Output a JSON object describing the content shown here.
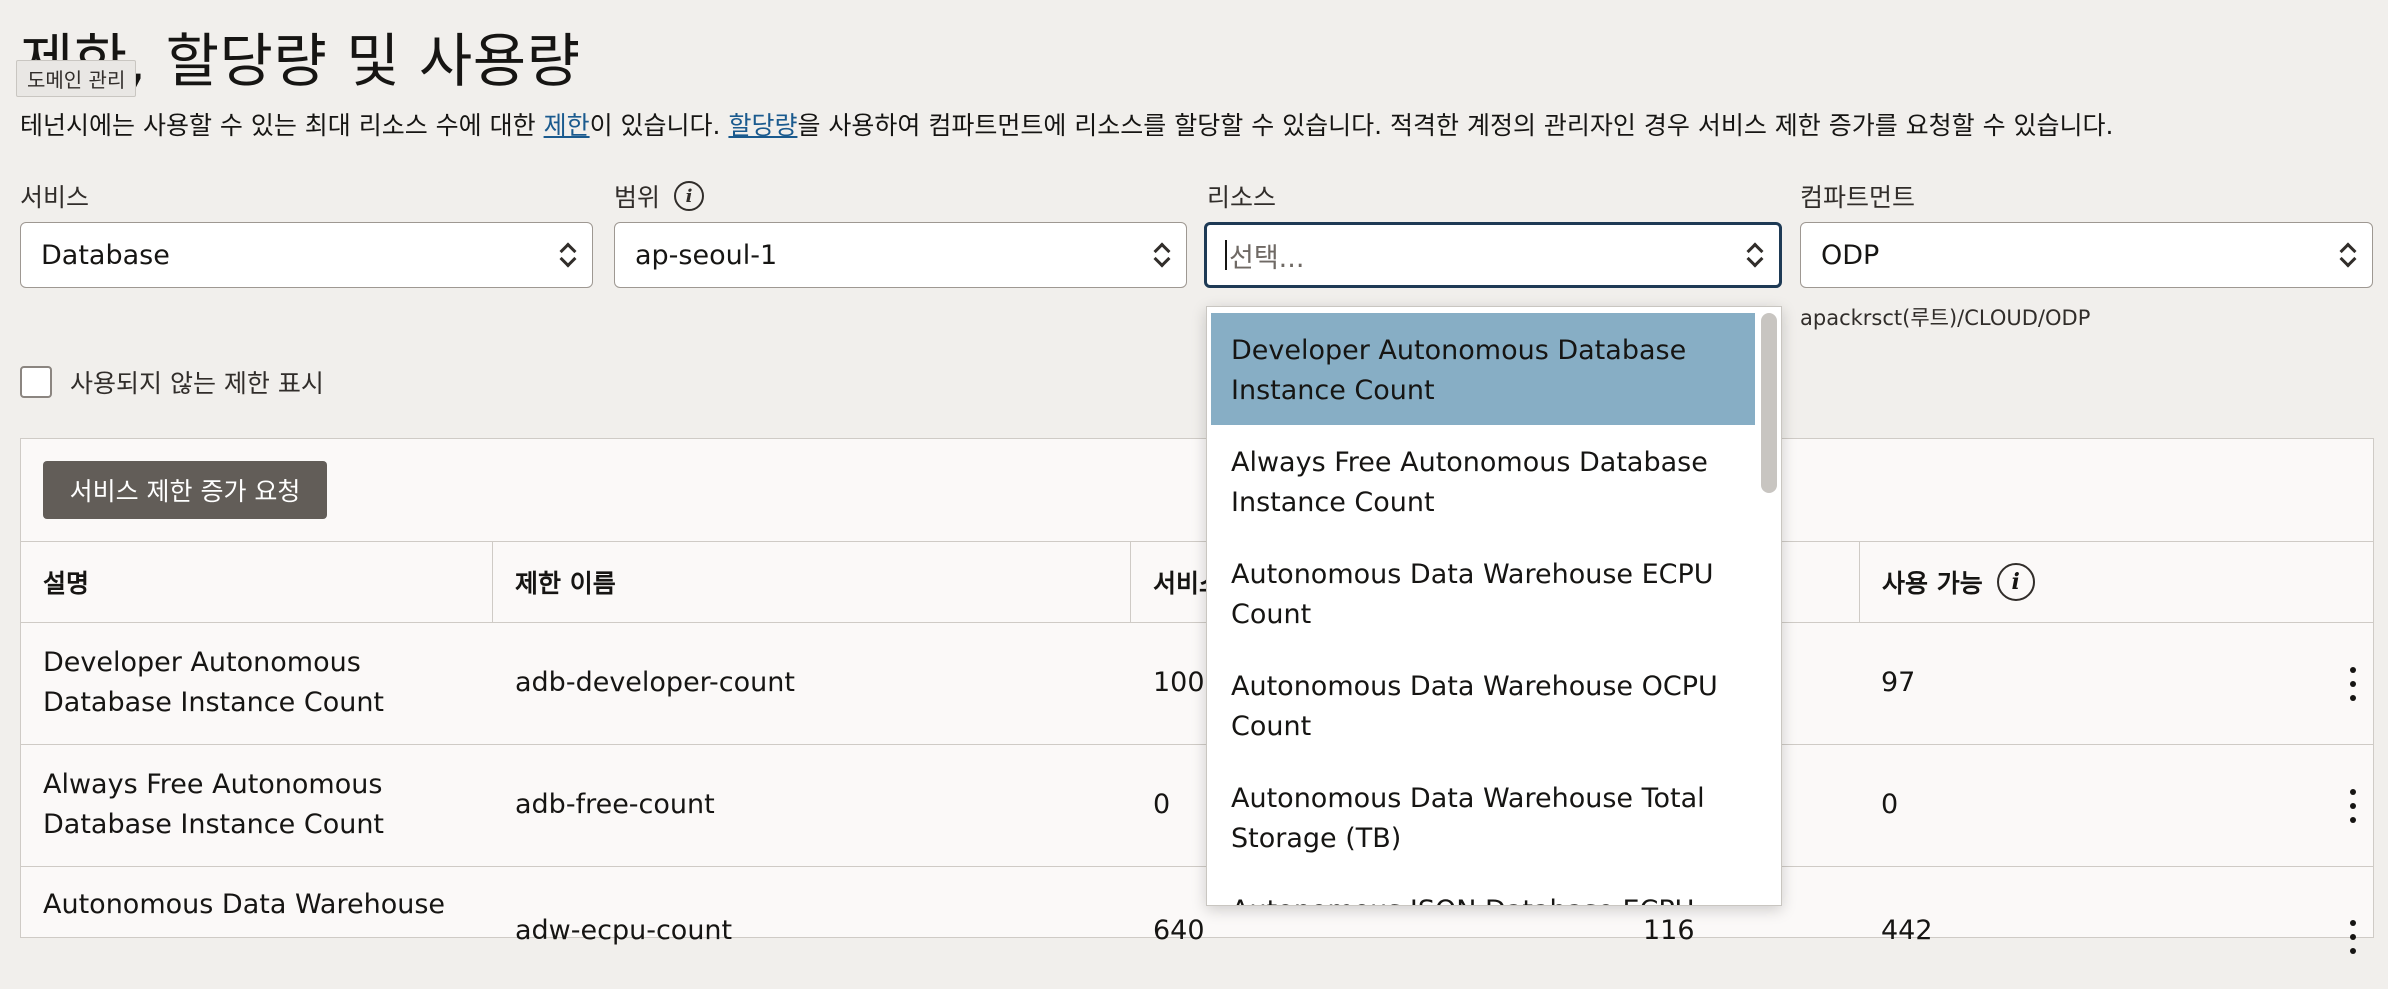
{
  "page": {
    "title": "제한, 할당량 및 사용량",
    "tooltip": "도메인 관리",
    "description": {
      "part1": "테넌시에는 사용할 수 있는 최대 리소스 수에 대한 ",
      "link1": "제한",
      "part2": "이 있습니다. ",
      "link2": "할당량",
      "part3": "을 사용하여 컴파트먼트에 리소스를 할당할 수 있습니다. 적격한 계정의 관리자인 경우 서비스 제한 증가를 요청할 수 있습니다."
    }
  },
  "filters": {
    "service": {
      "label": "서비스",
      "value": "Database"
    },
    "scope": {
      "label": "범위",
      "value": "ap-seoul-1"
    },
    "resource": {
      "label": "리소스",
      "placeholder": "선택..."
    },
    "compartment": {
      "label": "컴파트먼트",
      "value": "ODP",
      "path": "apackrsct(루트)/CLOUD/ODP"
    }
  },
  "checkbox": {
    "label": "사용되지 않는 제한 표시",
    "checked": false
  },
  "actions": {
    "request_button": "서비스 제한 증가 요청"
  },
  "table": {
    "headers": {
      "description": "설명",
      "limit_name": "제한 이름",
      "service_limit": "서비스",
      "available": "사용 가능"
    },
    "rows": [
      {
        "description": "Developer Autonomous Database Instance Count",
        "limit_name": "adb-developer-count",
        "service_limit": "100",
        "usage": "",
        "available": "97"
      },
      {
        "description": "Always Free Autonomous Database Instance Count",
        "limit_name": "adb-free-count",
        "service_limit": "0",
        "usage": "",
        "available": "0"
      },
      {
        "description": "Autonomous Data Warehouse",
        "limit_name": "adw-ecpu-count",
        "service_limit": "640",
        "usage": "116",
        "available": "442"
      }
    ]
  },
  "dropdown": {
    "options": [
      {
        "label": "Developer Autonomous Database Instance Count",
        "highlighted": true
      },
      {
        "label": "Always Free Autonomous Database Instance Count",
        "highlighted": false
      },
      {
        "label": "Autonomous Data Warehouse ECPU Count",
        "highlighted": false
      },
      {
        "label": "Autonomous Data Warehouse OCPU Count",
        "highlighted": false
      },
      {
        "label": "Autonomous Data Warehouse Total Storage (TB)",
        "highlighted": false
      },
      {
        "label": "Autonomous JSON Database ECPU",
        "highlighted": false
      }
    ]
  }
}
